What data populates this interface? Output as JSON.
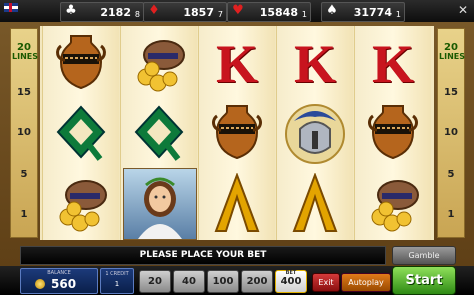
{
  "top_bar": {
    "close_symbol": "✕",
    "jackpots": [
      {
        "suit": "♣",
        "suit_name": "clubs",
        "value": "2182",
        "sub": "8",
        "color": "#ffffff"
      },
      {
        "suit": "♦",
        "suit_name": "diamonds",
        "value": "1857",
        "sub": "7",
        "color": "#e02020"
      },
      {
        "suit": "♥",
        "suit_name": "hearts",
        "value": "15848",
        "sub": "1",
        "color": "#e02020"
      },
      {
        "suit": "♠",
        "suit_name": "spades",
        "value": "31774",
        "sub": "1",
        "color": "#ffffff"
      }
    ]
  },
  "lines_panel": {
    "count": "20",
    "label": "LINES",
    "markers": [
      "15",
      "10",
      "5",
      "1"
    ]
  },
  "reels": [
    [
      "amphora",
      "Q",
      "coin-pot"
    ],
    [
      "coin-pot",
      "Q",
      "goddess"
    ],
    [
      "K",
      "amphora",
      "A"
    ],
    [
      "K",
      "helmet",
      "A"
    ],
    [
      "K",
      "amphora",
      "coin-pot"
    ]
  ],
  "message": "PLEASE PLACE YOUR BET",
  "gamble_label": "Gamble",
  "balance": {
    "label": "BALANCE",
    "value": "560"
  },
  "credit": {
    "label": "1 CREDIT",
    "value": "1"
  },
  "bets": [
    {
      "value": "20",
      "selected": false
    },
    {
      "value": "40",
      "selected": false
    },
    {
      "value": "100",
      "selected": false
    },
    {
      "value": "200",
      "selected": false
    },
    {
      "value": "400",
      "selected": true,
      "tag": "BET"
    }
  ],
  "buttons": {
    "exit": "Exit",
    "autoplay": "Autoplay",
    "start": "Start"
  },
  "colors": {
    "king": "#c8141e",
    "queen": "#0d7a3a",
    "ace": "#e3a400",
    "start": "#2e8a14",
    "exit": "#8a0f0f",
    "autoplay": "#e07a1a"
  }
}
